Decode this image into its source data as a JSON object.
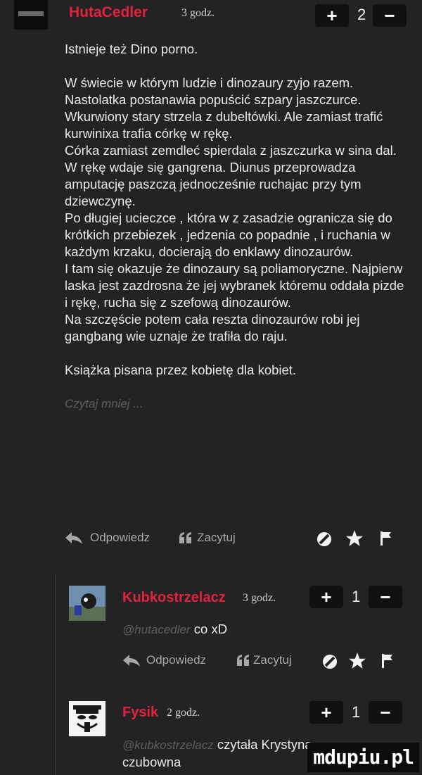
{
  "comments": [
    {
      "author": "HutaCedler",
      "time": "3 godz.",
      "votes": "2",
      "text": [
        "Istnieje też Dino porno.",
        "W świecie w którym ludzie i dinozaury zyjo razem. Nastolatka postanawia popuścić szpary jaszczurce. Wkurwiony stary strzela z dubeltówki. Ale zamiast trafić kurwinixa trafia córkę w rękę.",
        "Córka zamiast zemdleć spierdala z jaszczurka w sina dal.",
        "W rękę wdaje się gangrena. Diunus przeprowadza amputację paszczą jednocześnie ruchajac przy tym dziewczynę.",
        "Po długiej ucieczce , która w z zasadzie ogranicza się do krótkich przebiezek , jedzenia co popadnie , i ruchania w każdym krzaku, docierają do enklawy dinozaurów.",
        "I tam się okazuje że dinozaury są poliamoryczne. Najpierw laska jest zazdrosna że jej wybranek któremu oddała pizde i rękę, rucha się z szefową dinozaurów.",
        "Na szczęście potem cała reszta dinozaurów robi jej gangbang wie uznaje że trafiła do raju.",
        "Książka pisana przez kobietę dla kobiet."
      ],
      "read_more": "Czytaj mniej ...",
      "reply_label": "Odpowiedz",
      "quote_label": "Zacytuj"
    },
    {
      "author": "Kubkostrzelacz",
      "time": "3 godz.",
      "votes": "1",
      "mention": "@hutacedler",
      "text": "co xD",
      "reply_label": "Odpowiedz",
      "quote_label": "Zacytuj"
    },
    {
      "author": "Fysik",
      "time": "2 godz.",
      "votes": "1",
      "mention": "@kubkostrzelacz",
      "text": "czytała Krystyna czubowna"
    }
  ],
  "vote_plus": "+",
  "vote_minus": "−",
  "watermark": "mdupiu.pl",
  "colors": {
    "background": "#232325",
    "author": "#e3223e",
    "muted": "#5e5e62"
  }
}
